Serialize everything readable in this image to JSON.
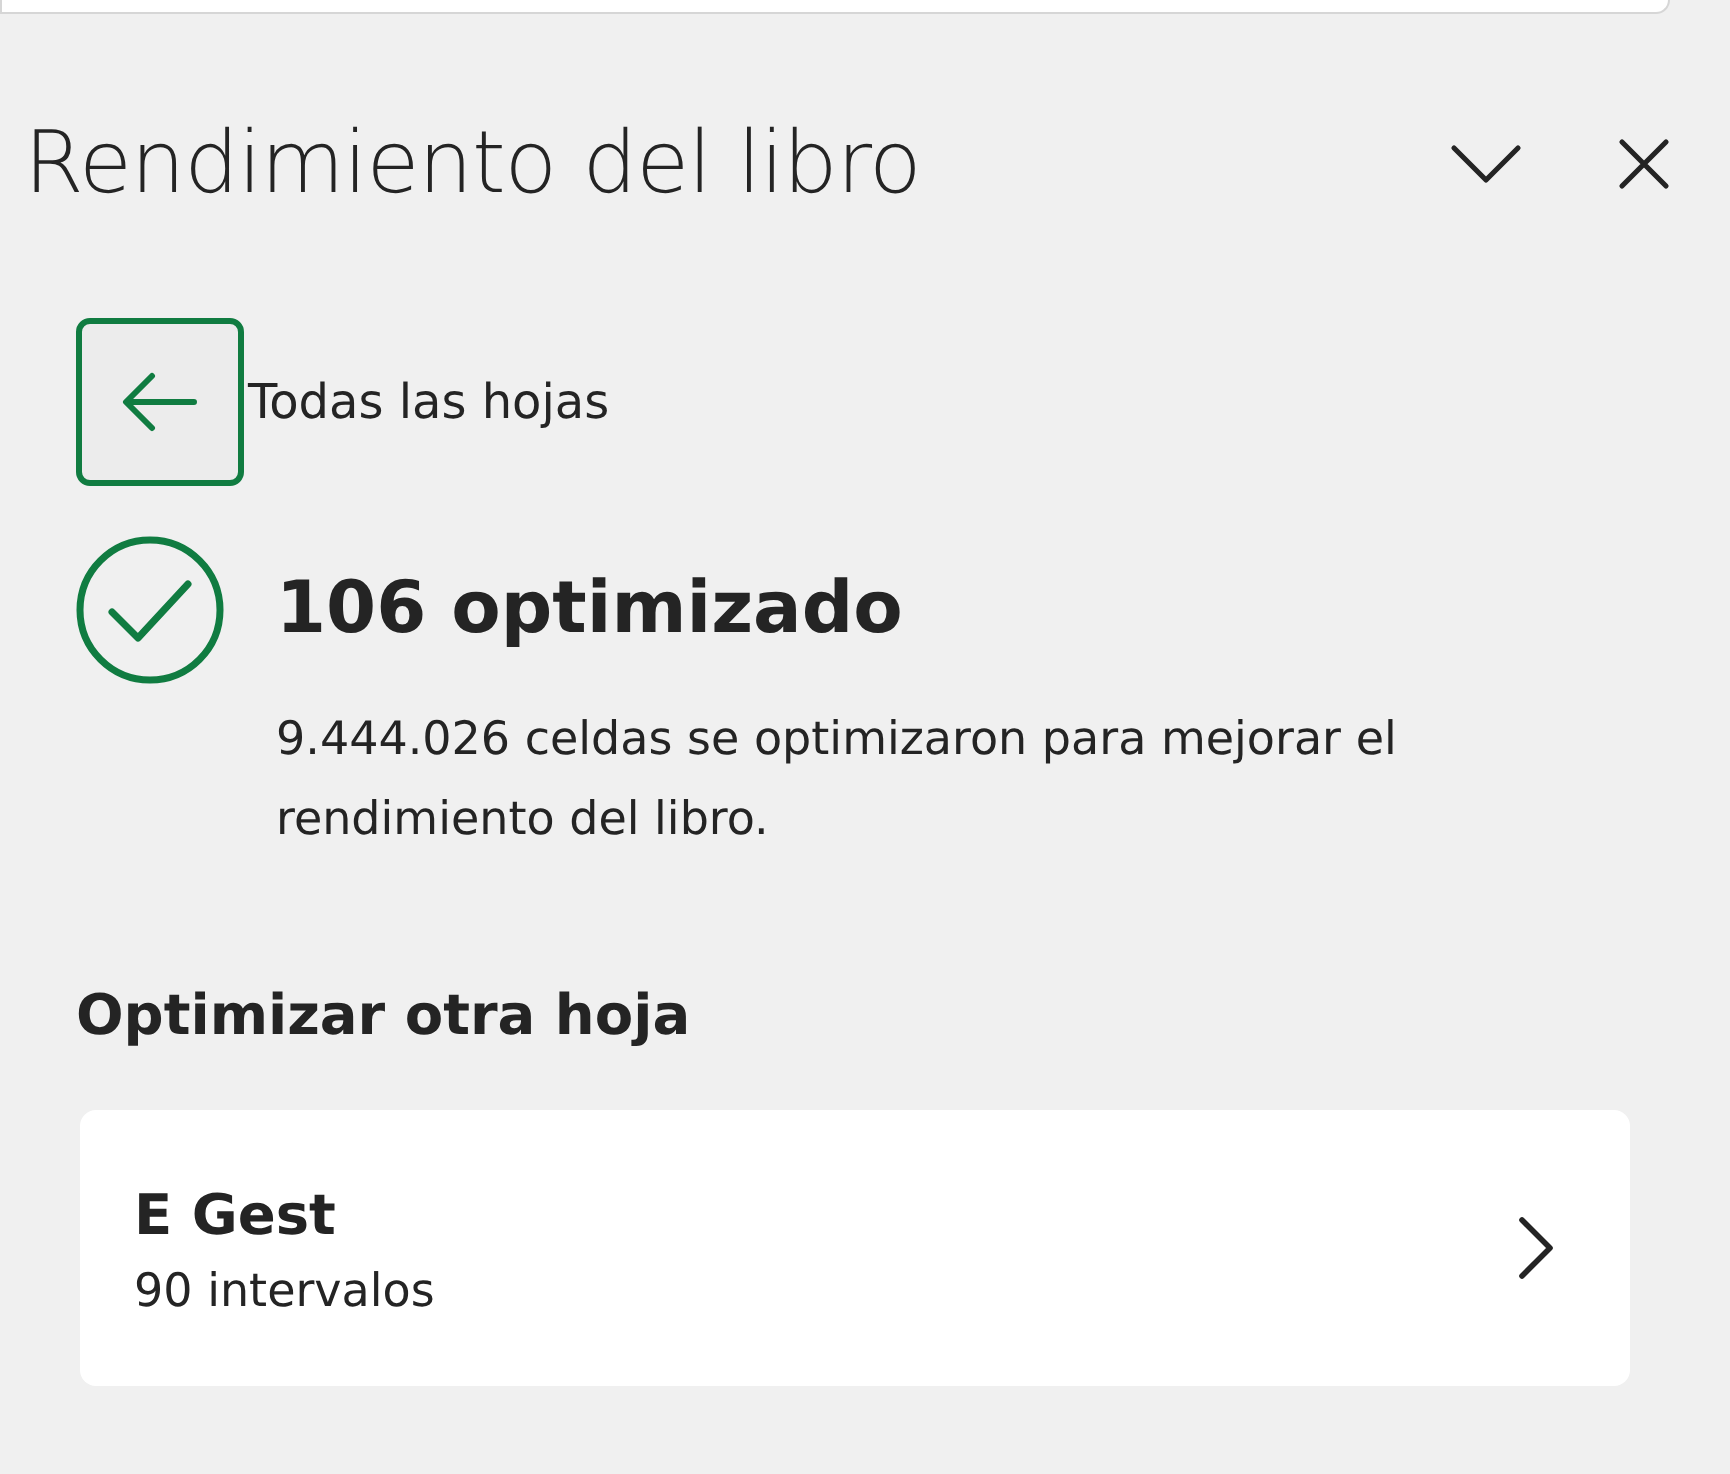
{
  "panel": {
    "title": "Rendimiento del libro"
  },
  "back_link": {
    "label": "Todas las hojas"
  },
  "result": {
    "title": "106 optimizado",
    "description": "9.444.026 celdas se optimizaron para mejorar el rendimiento del libro."
  },
  "section": {
    "heading": "Optimizar otra hoja",
    "sheets": [
      {
        "name": "E Gest",
        "detail": "90 intervalos"
      }
    ]
  }
}
